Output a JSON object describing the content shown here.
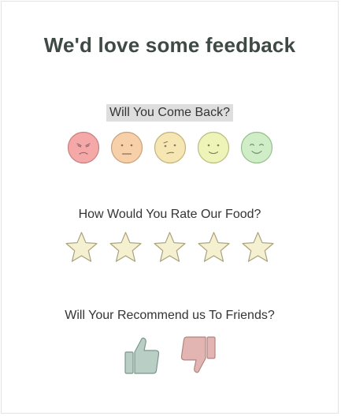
{
  "title": "We'd love some feedback",
  "questions": {
    "come_back": {
      "label": "Will You Come Back?",
      "options": [
        {
          "icon": "angry-face-icon",
          "fill": "#f4a9a8",
          "stroke": "#c9807e"
        },
        {
          "icon": "neutral-face-icon",
          "fill": "#f7d0a9",
          "stroke": "#c9a17a"
        },
        {
          "icon": "unsure-face-icon",
          "fill": "#f6e6b3",
          "stroke": "#c4b27a"
        },
        {
          "icon": "content-face-icon",
          "fill": "#eef3b8",
          "stroke": "#b8be7f"
        },
        {
          "icon": "happy-face-icon",
          "fill": "#cfeec7",
          "stroke": "#94c08a"
        }
      ]
    },
    "food_rating": {
      "label": "How Would You Rate Our Food?",
      "star_count": 5,
      "star_fill": "#f5f0cf",
      "star_stroke": "#a7a07c"
    },
    "recommend": {
      "label": "Will Your Recommend us To Friends?",
      "thumbs_up": {
        "icon": "thumbs-up-icon",
        "fill": "#b9cfc6",
        "stroke": "#7d958b"
      },
      "thumbs_down": {
        "icon": "thumbs-down-icon",
        "fill": "#e3b5b2",
        "stroke": "#b08581"
      }
    }
  }
}
